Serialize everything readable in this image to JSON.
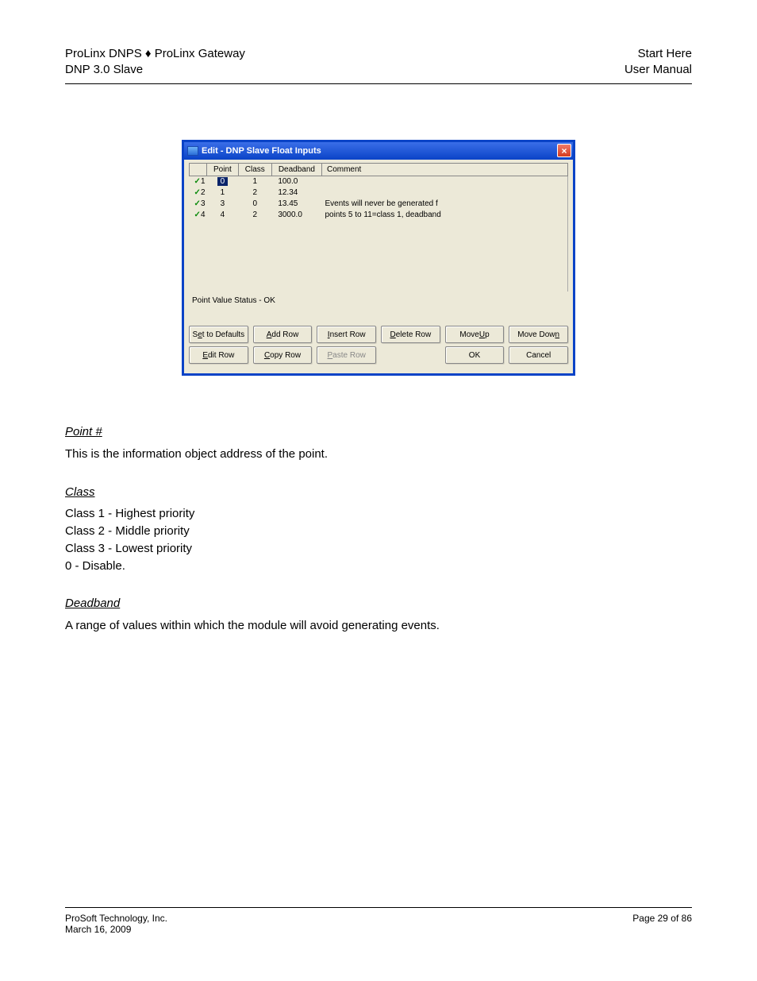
{
  "header": {
    "left1": "ProLinx DNPS ♦ ProLinx Gateway",
    "left2": "DNP 3.0 Slave",
    "right1": "Start Here",
    "right2": "User Manual"
  },
  "dialog": {
    "title": "Edit - DNP Slave Float Inputs",
    "close_x": "×",
    "columns": {
      "blank": "",
      "point": "Point",
      "class": "Class",
      "deadband": "Deadband",
      "comment": "Comment"
    },
    "rows": [
      {
        "idx": "1",
        "point": "0",
        "class": "1",
        "deadband": "100.0",
        "comment": "",
        "selected": true
      },
      {
        "idx": "2",
        "point": "1",
        "class": "2",
        "deadband": "12.34",
        "comment": ""
      },
      {
        "idx": "3",
        "point": "3",
        "class": "0",
        "deadband": "13.45",
        "comment": "Events will never be generated f"
      },
      {
        "idx": "4",
        "point": "4",
        "class": "2",
        "deadband": "3000.0",
        "comment": "points 5 to 11=class 1, deadband"
      }
    ],
    "status": "Point Value Status - OK",
    "buttons": {
      "set_defaults": {
        "pre": "S",
        "ul": "e",
        "post": "t to Defaults"
      },
      "add_row": {
        "pre": "",
        "ul": "A",
        "post": "dd Row"
      },
      "insert_row": {
        "pre": "",
        "ul": "I",
        "post": "nsert Row"
      },
      "delete_row": {
        "pre": "",
        "ul": "D",
        "post": "elete Row"
      },
      "move_up": {
        "pre": "Move ",
        "ul": "U",
        "post": "p"
      },
      "move_down": {
        "pre": "Move Dow",
        "ul": "n",
        "post": ""
      },
      "edit_row": {
        "pre": "",
        "ul": "E",
        "post": "dit Row"
      },
      "copy_row": {
        "pre": "",
        "ul": "C",
        "post": "opy Row"
      },
      "paste_row": {
        "pre": "",
        "ul": "P",
        "post": "aste Row"
      },
      "ok": {
        "pre": "OK",
        "ul": "",
        "post": ""
      },
      "cancel": {
        "pre": "Cancel",
        "ul": "",
        "post": ""
      }
    }
  },
  "sections": {
    "point_h": "Point #",
    "point_p": "This is the information object address of the point.",
    "class_h": "Class",
    "class_p1": "Class 1 - Highest priority",
    "class_p2": "Class 2 - Middle priority",
    "class_p3": "Class 3 - Lowest priority",
    "class_p4": "0 - Disable.",
    "deadband_h": "Deadband",
    "deadband_p": "A range of values within which the module will avoid generating events."
  },
  "footer": {
    "left": "ProSoft Technology, Inc.",
    "right": "Page 29 of 86",
    "date": "March 16, 2009"
  }
}
